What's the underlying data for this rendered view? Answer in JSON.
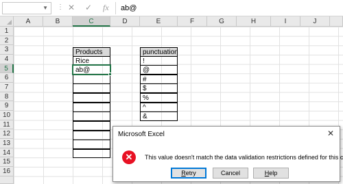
{
  "formula_bar": {
    "name_box": "",
    "cancel_icon": "✕",
    "enter_icon": "✓",
    "function_icon": "fx",
    "formula": "ab@"
  },
  "columns": [
    "A",
    "B",
    "C",
    "D",
    "E",
    "F",
    "G",
    "H",
    "I",
    "J"
  ],
  "rows": [
    "1",
    "2",
    "3",
    "4",
    "5",
    "6",
    "7",
    "8",
    "9",
    "10",
    "11",
    "12",
    "13",
    "14",
    "15",
    "16"
  ],
  "active_cell": "C5",
  "products_table": {
    "header": "Products",
    "values": [
      "Rice",
      "ab@"
    ]
  },
  "punctuation_table": {
    "header": "punctuation",
    "values": [
      "!",
      "@",
      "#",
      "$",
      "%",
      "^",
      "&"
    ]
  },
  "dialog": {
    "title": "Microsoft Excel",
    "close_icon": "✕",
    "error_icon": "✕",
    "message": "This value doesn't match the data validation restrictions defined for this cell.",
    "buttons": {
      "retry": {
        "label": "Retry",
        "accel": "R",
        "rest": "etry"
      },
      "cancel": {
        "label": "Cancel"
      },
      "help": {
        "label": "Help",
        "accel": "H",
        "rest": "elp"
      }
    }
  }
}
